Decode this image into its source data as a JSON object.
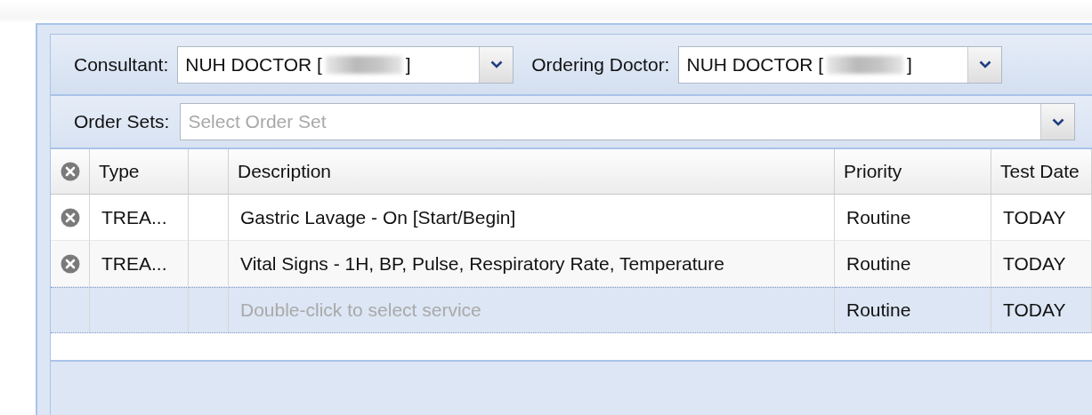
{
  "consultant": {
    "label": "Consultant:",
    "value": "NUH DOCTOR [",
    "value_end": "]",
    "redacted": true
  },
  "ordering_doctor": {
    "label": "Ordering Doctor:",
    "value": "NUH DOCTOR [",
    "value_end": "]",
    "redacted": true
  },
  "order_sets": {
    "label": "Order Sets:",
    "placeholder": "Select Order Set"
  },
  "grid": {
    "columns": [
      {
        "kind": "remove"
      },
      {
        "kind": "text",
        "label": "Type"
      },
      {
        "kind": "blank"
      },
      {
        "kind": "text",
        "label": "Description"
      },
      {
        "kind": "text",
        "label": "Priority"
      },
      {
        "kind": "text",
        "label": "Test Date"
      }
    ],
    "rows": [
      {
        "kind": "item",
        "selected": false,
        "type": "TREA...",
        "description": "Gastric Lavage - On [Start/Begin]",
        "priority": "Routine",
        "test_date": "TODAY"
      },
      {
        "kind": "item",
        "selected": false,
        "type": "TREA...",
        "description": "Vital Signs - 1H, BP, Pulse, Respiratory Rate, Temperature",
        "priority": "Routine",
        "test_date": "TODAY"
      },
      {
        "kind": "new",
        "selected": true,
        "placeholder": "Double-click to select service",
        "priority": "Routine",
        "test_date": "TODAY"
      }
    ]
  }
}
